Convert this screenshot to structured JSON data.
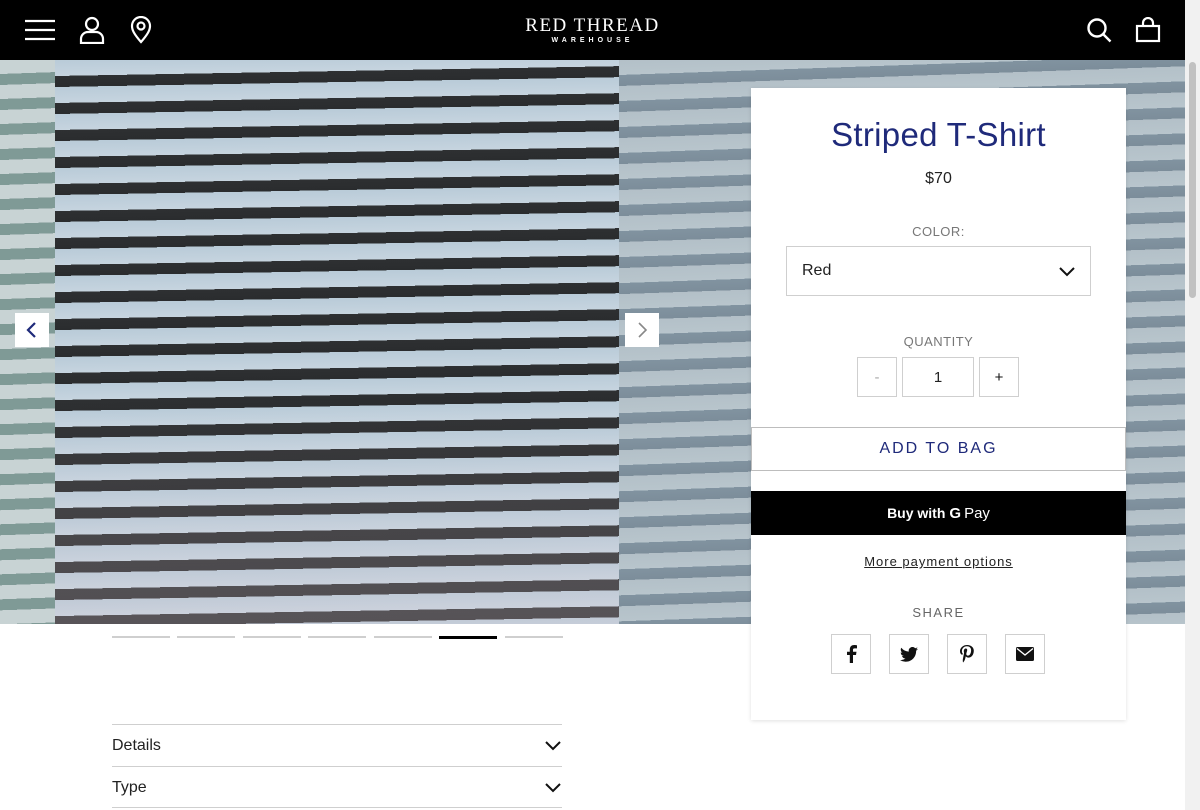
{
  "header": {
    "brand": "RED THREAD",
    "brand_sub": "WAREHOUSE",
    "icons": [
      "menu-icon",
      "account-icon",
      "location-icon",
      "search-icon",
      "cart-icon"
    ]
  },
  "gallery": {
    "slide_count": 7,
    "active_slide": 6
  },
  "product": {
    "title": "Striped T-Shirt",
    "price": "$70",
    "color_label": "COLOR:",
    "color_value": "Red",
    "quantity_label": "QUANTITY",
    "qty_minus": "-",
    "quantity": "1",
    "qty_plus": "+",
    "add_to_bag": "ADD TO BAG",
    "gpay_buy": "Buy with",
    "gpay_g": "G",
    "gpay_pay": "Pay",
    "more_payment": "More payment options",
    "share_label": "SHARE",
    "share_icons": [
      "facebook-icon",
      "twitter-icon",
      "pinterest-icon",
      "email-icon"
    ]
  },
  "accordions": [
    {
      "label": "Details"
    },
    {
      "label": "Type"
    }
  ],
  "colors": {
    "header_bg": "#000000",
    "accent": "#1f2a7a",
    "gpay_bg": "#000000"
  }
}
